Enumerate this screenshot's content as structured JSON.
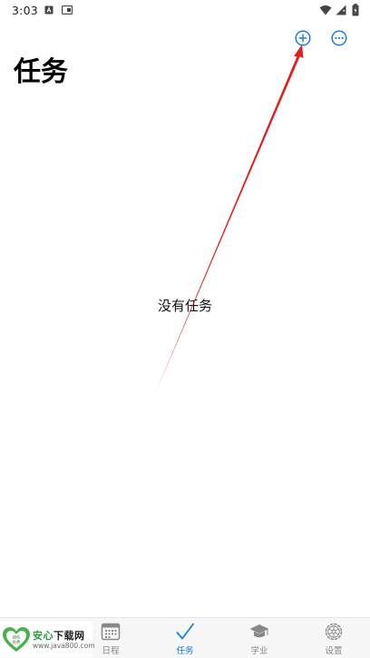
{
  "status_bar": {
    "time": "3:03"
  },
  "header": {
    "add_icon": "plus-circle-icon",
    "more_icon": "more-circle-icon"
  },
  "page": {
    "title": "任务",
    "empty_message": "没有任务"
  },
  "tabs": [
    {
      "label": "日程",
      "icon": "calendar-icon"
    },
    {
      "label": "任务",
      "icon": "checkmark-icon",
      "active": true
    },
    {
      "label": "学业",
      "icon": "graduation-cap-icon"
    },
    {
      "label": "设置",
      "icon": "gear-icon"
    }
  ],
  "watermark": {
    "name_green": "安心",
    "name_dark": "下载网",
    "url": "www.java800.com",
    "badge_line1": "绿色",
    "badge_line2": "免费"
  },
  "colors": {
    "accent": "#1a7fe0",
    "annotation": "#e02020"
  }
}
